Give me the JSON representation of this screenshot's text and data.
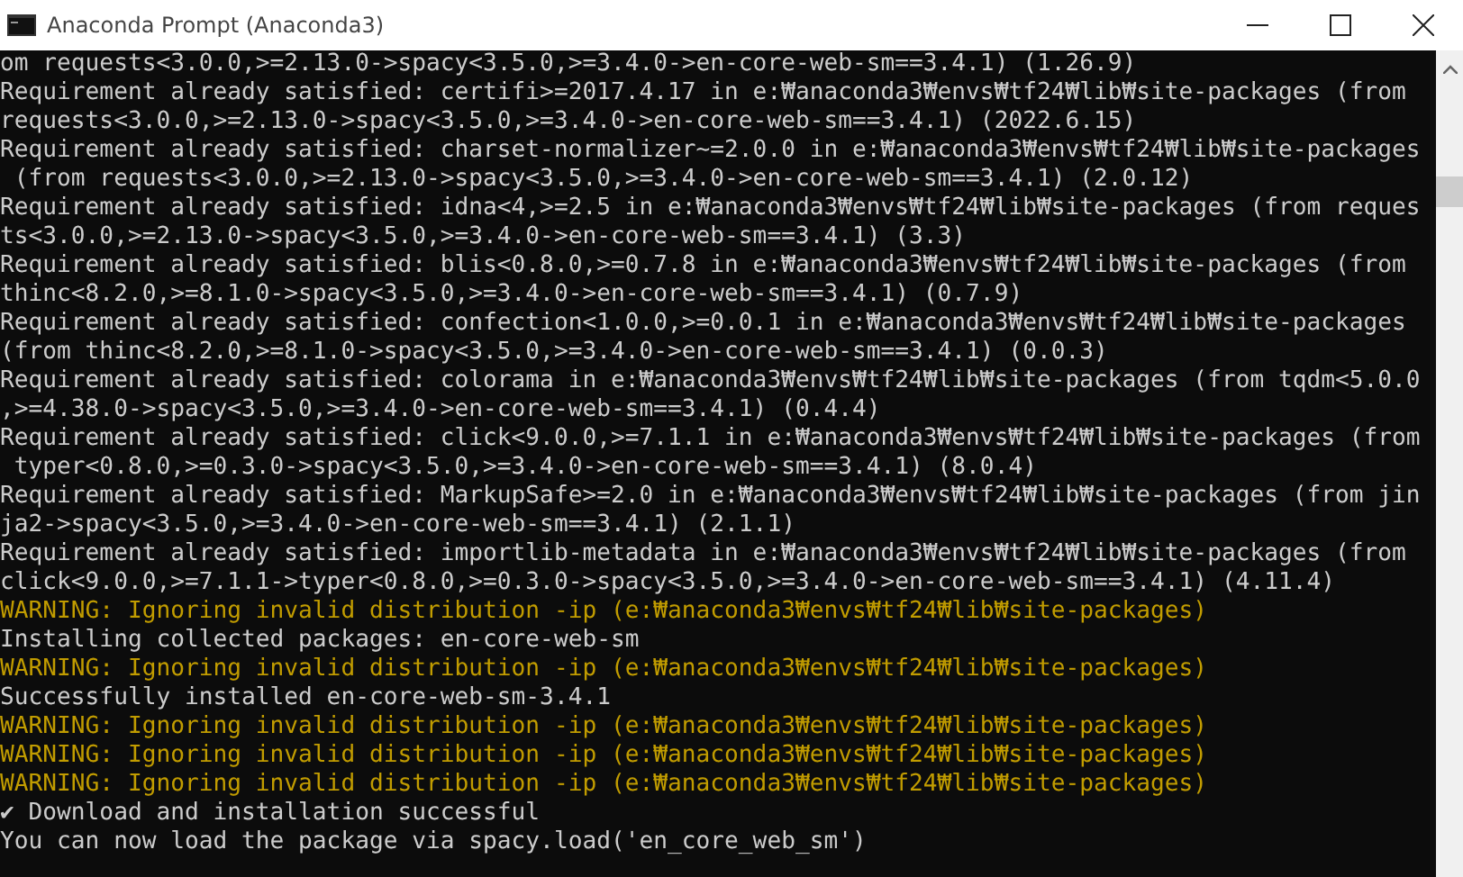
{
  "window": {
    "title": "Anaconda Prompt (Anaconda3)"
  },
  "console": {
    "lines": [
      {
        "kind": "normal",
        "text": "om requests<3.0.0,>=2.13.0->spacy<3.5.0,>=3.4.0->en-core-web-sm==3.4.1) (1.26.9)"
      },
      {
        "kind": "normal",
        "text": "Requirement already satisfied: certifi>=2017.4.17 in e:₩anaconda3₩envs₩tf24₩lib₩site-packages (from"
      },
      {
        "kind": "normal",
        "text": "requests<3.0.0,>=2.13.0->spacy<3.5.0,>=3.4.0->en-core-web-sm==3.4.1) (2022.6.15)"
      },
      {
        "kind": "normal",
        "text": "Requirement already satisfied: charset-normalizer~=2.0.0 in e:₩anaconda3₩envs₩tf24₩lib₩site-packages"
      },
      {
        "kind": "normal",
        "text": " (from requests<3.0.0,>=2.13.0->spacy<3.5.0,>=3.4.0->en-core-web-sm==3.4.1) (2.0.12)"
      },
      {
        "kind": "normal",
        "text": "Requirement already satisfied: idna<4,>=2.5 in e:₩anaconda3₩envs₩tf24₩lib₩site-packages (from reques"
      },
      {
        "kind": "normal",
        "text": "ts<3.0.0,>=2.13.0->spacy<3.5.0,>=3.4.0->en-core-web-sm==3.4.1) (3.3)"
      },
      {
        "kind": "normal",
        "text": "Requirement already satisfied: blis<0.8.0,>=0.7.8 in e:₩anaconda3₩envs₩tf24₩lib₩site-packages (from"
      },
      {
        "kind": "normal",
        "text": "thinc<8.2.0,>=8.1.0->spacy<3.5.0,>=3.4.0->en-core-web-sm==3.4.1) (0.7.9)"
      },
      {
        "kind": "normal",
        "text": "Requirement already satisfied: confection<1.0.0,>=0.0.1 in e:₩anaconda3₩envs₩tf24₩lib₩site-packages"
      },
      {
        "kind": "normal",
        "text": "(from thinc<8.2.0,>=8.1.0->spacy<3.5.0,>=3.4.0->en-core-web-sm==3.4.1) (0.0.3)"
      },
      {
        "kind": "normal",
        "text": "Requirement already satisfied: colorama in e:₩anaconda3₩envs₩tf24₩lib₩site-packages (from tqdm<5.0.0"
      },
      {
        "kind": "normal",
        "text": ",>=4.38.0->spacy<3.5.0,>=3.4.0->en-core-web-sm==3.4.1) (0.4.4)"
      },
      {
        "kind": "normal",
        "text": "Requirement already satisfied: click<9.0.0,>=7.1.1 in e:₩anaconda3₩envs₩tf24₩lib₩site-packages (from"
      },
      {
        "kind": "normal",
        "text": " typer<0.8.0,>=0.3.0->spacy<3.5.0,>=3.4.0->en-core-web-sm==3.4.1) (8.0.4)"
      },
      {
        "kind": "normal",
        "text": "Requirement already satisfied: MarkupSafe>=2.0 in e:₩anaconda3₩envs₩tf24₩lib₩site-packages (from jin"
      },
      {
        "kind": "normal",
        "text": "ja2->spacy<3.5.0,>=3.4.0->en-core-web-sm==3.4.1) (2.1.1)"
      },
      {
        "kind": "normal",
        "text": "Requirement already satisfied: importlib-metadata in e:₩anaconda3₩envs₩tf24₩lib₩site-packages (from"
      },
      {
        "kind": "normal",
        "text": "click<9.0.0,>=7.1.1->typer<0.8.0,>=0.3.0->spacy<3.5.0,>=3.4.0->en-core-web-sm==3.4.1) (4.11.4)"
      },
      {
        "kind": "warning",
        "text": "WARNING: Ignoring invalid distribution -ip (e:₩anaconda3₩envs₩tf24₩lib₩site-packages)"
      },
      {
        "kind": "normal",
        "text": "Installing collected packages: en-core-web-sm"
      },
      {
        "kind": "warning",
        "text": "WARNING: Ignoring invalid distribution -ip (e:₩anaconda3₩envs₩tf24₩lib₩site-packages)"
      },
      {
        "kind": "normal",
        "text": "Successfully installed en-core-web-sm-3.4.1"
      },
      {
        "kind": "warning",
        "text": "WARNING: Ignoring invalid distribution -ip (e:₩anaconda3₩envs₩tf24₩lib₩site-packages)"
      },
      {
        "kind": "warning",
        "text": "WARNING: Ignoring invalid distribution -ip (e:₩anaconda3₩envs₩tf24₩lib₩site-packages)"
      },
      {
        "kind": "warning",
        "text": "WARNING: Ignoring invalid distribution -ip (e:₩anaconda3₩envs₩tf24₩lib₩site-packages)"
      },
      {
        "kind": "normal",
        "text": "✔ Download and installation successful"
      },
      {
        "kind": "normal",
        "text": "You can now load the package via spacy.load('en_core_web_sm')"
      }
    ]
  }
}
